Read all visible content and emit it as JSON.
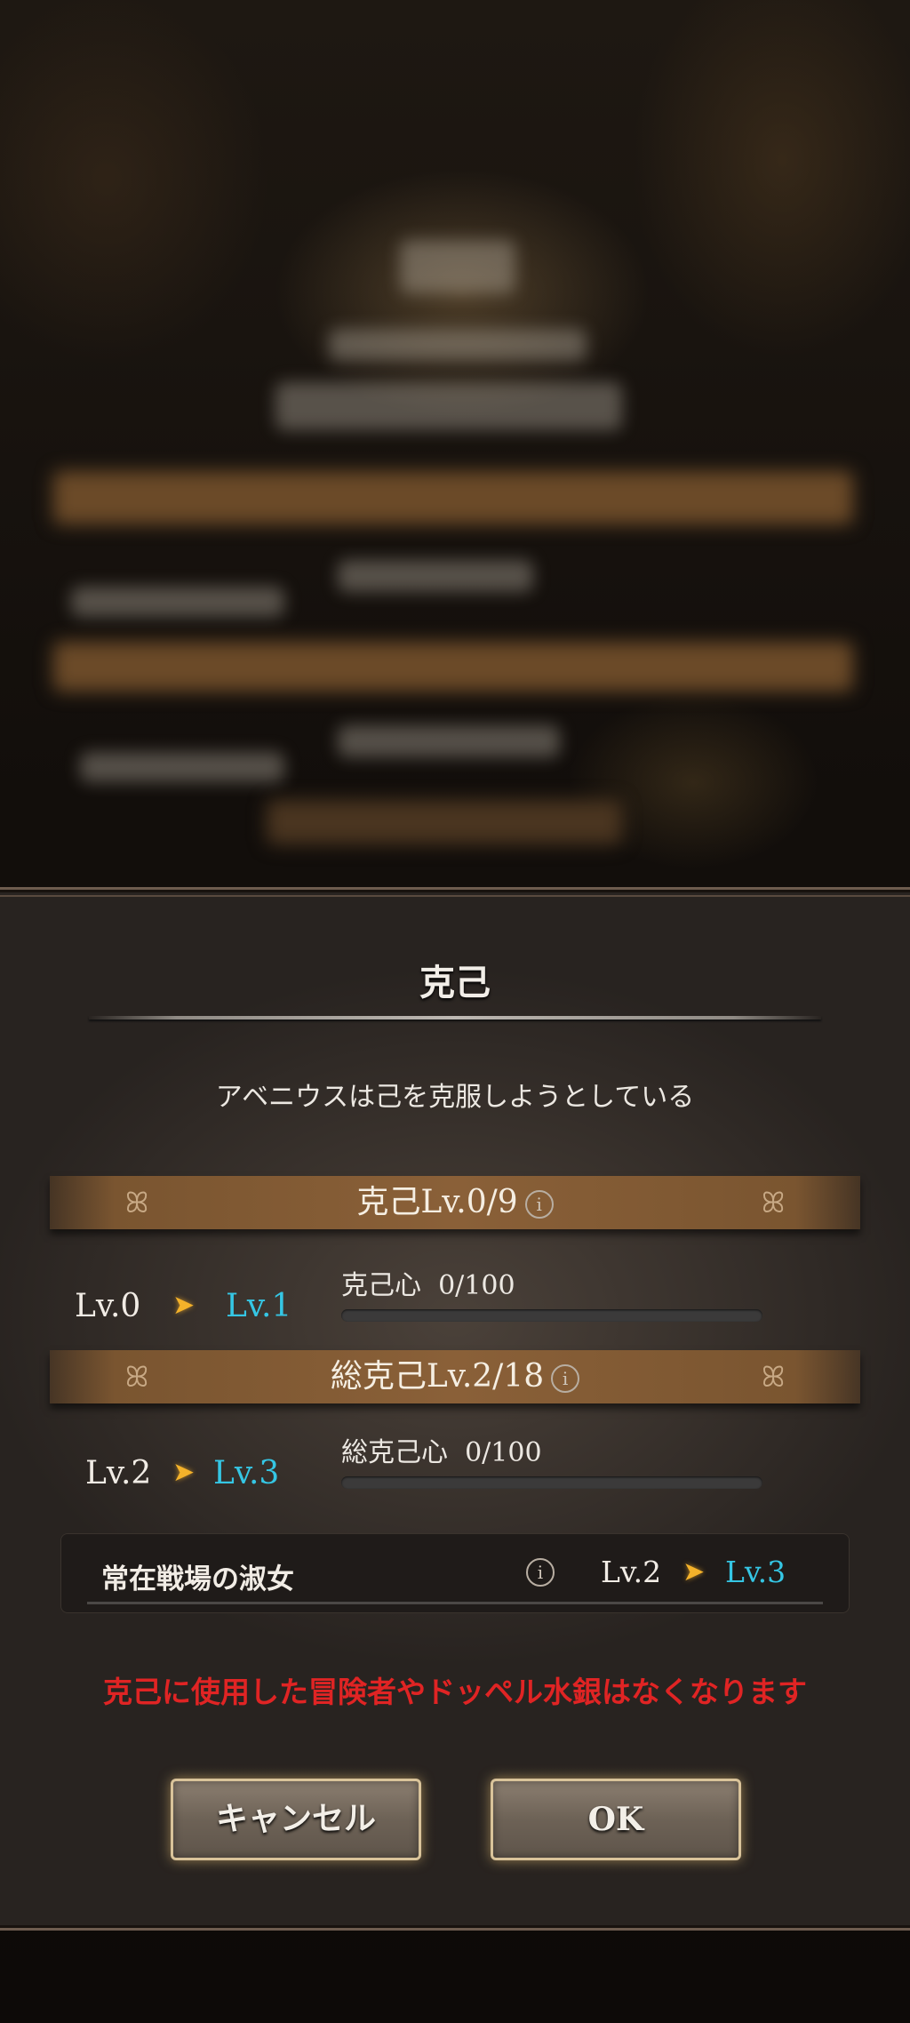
{
  "dialog": {
    "title": "克己",
    "subtitle": "アベニウスは己を克服しようとしている",
    "section1": {
      "banner": "克己Lv.0/9",
      "from": "Lv.0",
      "to": "Lv.1",
      "gauge_label": "克己心",
      "gauge_value": "0/100",
      "progress": 0
    },
    "section2": {
      "banner": "総克己Lv.2/18",
      "from": "Lv.2",
      "to": "Lv.3",
      "gauge_label": "総克己心",
      "gauge_value": "0/100",
      "progress": 0
    },
    "skill": {
      "name": "常在戦場の淑女",
      "from": "Lv.2",
      "to": "Lv.3"
    },
    "warning": "克己に使用した冒険者やドッペル水銀はなくなります",
    "buttons": {
      "cancel": "キャンセル",
      "ok": "OK"
    },
    "info_icon_glyph": "i",
    "arrow_glyph": "➤",
    "ornament_left": "ꕤ",
    "ornament_right": "ꕤ"
  },
  "colors": {
    "next_level": "#35c6e4",
    "arrow": "#f4b22a",
    "warning": "#e02424",
    "banner": "#8a6038"
  }
}
